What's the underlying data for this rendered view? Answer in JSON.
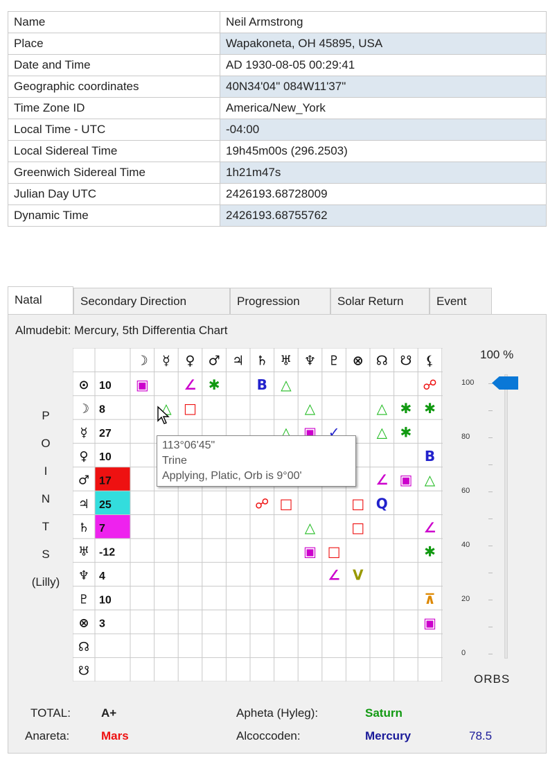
{
  "info": [
    {
      "key": "Name",
      "value": "Neil Armstrong"
    },
    {
      "key": "Place",
      "value": "Wapakoneta, OH 45895, USA"
    },
    {
      "key": "Date and Time",
      "value": "AD 1930-08-05 00:29:41"
    },
    {
      "key": "Geographic coordinates",
      "value": "40N34'04\" 084W11'37\""
    },
    {
      "key": "Time Zone ID",
      "value": "America/New_York"
    },
    {
      "key": "Local Time - UTC",
      "value": "-04:00"
    },
    {
      "key": "Local Sidereal Time",
      "value": "19h45m00s (296.2503)"
    },
    {
      "key": "Greenwich Sidereal Time",
      "value": "1h21m47s"
    },
    {
      "key": "Julian Day UTC",
      "value": "2426193.68728009"
    },
    {
      "key": "Dynamic Time",
      "value": "2426193.68755762"
    }
  ],
  "tabs": [
    {
      "label": "Natal",
      "active": true
    },
    {
      "label": "Secondary Direction",
      "active": false
    },
    {
      "label": "Progression",
      "active": false
    },
    {
      "label": "Solar Return",
      "active": false
    },
    {
      "label": "Event",
      "active": false
    }
  ],
  "chart_title": "Almudebit: Mercury, 5th Differentia Chart",
  "side_label": [
    "P",
    "O",
    "I",
    "N",
    "T",
    "S",
    "(Lilly)"
  ],
  "grid": {
    "columns": [
      "☽",
      "☿",
      "♀",
      "♂",
      "♃",
      "♄",
      "♅",
      "♆",
      "♇",
      "⊗",
      "☊",
      "☋",
      "⚸"
    ],
    "rows": [
      {
        "glyph": "⊙",
        "score": "10",
        "score_bg": ""
      },
      {
        "glyph": "☽",
        "score": "8",
        "score_bg": ""
      },
      {
        "glyph": "☿",
        "score": "27",
        "score_bg": ""
      },
      {
        "glyph": "♀",
        "score": "10",
        "score_bg": ""
      },
      {
        "glyph": "♂",
        "score": "17",
        "score_bg": "#ee1111"
      },
      {
        "glyph": "♃",
        "score": "25",
        "score_bg": "#33dddd"
      },
      {
        "glyph": "♄",
        "score": "7",
        "score_bg": "#ee22ee"
      },
      {
        "glyph": "♅",
        "score": "-12",
        "score_bg": ""
      },
      {
        "glyph": "♆",
        "score": "4",
        "score_bg": ""
      },
      {
        "glyph": "♇",
        "score": "10",
        "score_bg": ""
      },
      {
        "glyph": "⊗",
        "score": "3",
        "score_bg": ""
      },
      {
        "glyph": "☊",
        "score": "",
        "score_bg": ""
      },
      {
        "glyph": "☋",
        "score": "",
        "score_bg": ""
      }
    ],
    "aspects": [
      {
        "row": 0,
        "col": 0,
        "glyph": "▣",
        "color": "#cc00cc"
      },
      {
        "row": 0,
        "col": 2,
        "glyph": "∠",
        "color": "#cc00cc"
      },
      {
        "row": 0,
        "col": 3,
        "glyph": "✱",
        "color": "#119911"
      },
      {
        "row": 0,
        "col": 5,
        "glyph": "B",
        "color": "#2222cc"
      },
      {
        "row": 0,
        "col": 6,
        "glyph": "△",
        "color": "#22bb22"
      },
      {
        "row": 0,
        "col": 12,
        "glyph": "☍",
        "color": "#ee1111"
      },
      {
        "row": 1,
        "col": 1,
        "glyph": "△",
        "color": "#22bb22"
      },
      {
        "row": 1,
        "col": 2,
        "glyph": "□",
        "color": "#ee1111"
      },
      {
        "row": 1,
        "col": 7,
        "glyph": "△",
        "color": "#22bb22"
      },
      {
        "row": 1,
        "col": 10,
        "glyph": "△",
        "color": "#22bb22"
      },
      {
        "row": 1,
        "col": 11,
        "glyph": "✱",
        "color": "#119911"
      },
      {
        "row": 1,
        "col": 12,
        "glyph": "✱",
        "color": "#119911"
      },
      {
        "row": 2,
        "col": 6,
        "glyph": "△",
        "color": "#22bb22"
      },
      {
        "row": 2,
        "col": 7,
        "glyph": "▣",
        "color": "#cc00cc"
      },
      {
        "row": 2,
        "col": 8,
        "glyph": "✓",
        "color": "#2222cc"
      },
      {
        "row": 2,
        "col": 10,
        "glyph": "△",
        "color": "#22bb22"
      },
      {
        "row": 2,
        "col": 11,
        "glyph": "✱",
        "color": "#119911"
      },
      {
        "row": 3,
        "col": 12,
        "glyph": "B",
        "color": "#2222cc"
      },
      {
        "row": 4,
        "col": 10,
        "glyph": "∠",
        "color": "#cc00cc"
      },
      {
        "row": 4,
        "col": 11,
        "glyph": "▣",
        "color": "#cc00cc"
      },
      {
        "row": 4,
        "col": 12,
        "glyph": "△",
        "color": "#22bb22"
      },
      {
        "row": 5,
        "col": 5,
        "glyph": "☍",
        "color": "#ee1111"
      },
      {
        "row": 5,
        "col": 6,
        "glyph": "□",
        "color": "#ee1111"
      },
      {
        "row": 5,
        "col": 9,
        "glyph": "□",
        "color": "#ee1111"
      },
      {
        "row": 5,
        "col": 10,
        "glyph": "Q",
        "color": "#2222cc"
      },
      {
        "row": 6,
        "col": 7,
        "glyph": "△",
        "color": "#22bb22"
      },
      {
        "row": 6,
        "col": 9,
        "glyph": "□",
        "color": "#ee1111"
      },
      {
        "row": 6,
        "col": 12,
        "glyph": "∠",
        "color": "#cc00cc"
      },
      {
        "row": 7,
        "col": 7,
        "glyph": "▣",
        "color": "#cc00cc"
      },
      {
        "row": 7,
        "col": 8,
        "glyph": "□",
        "color": "#ee1111"
      },
      {
        "row": 7,
        "col": 12,
        "glyph": "✱",
        "color": "#119911"
      },
      {
        "row": 8,
        "col": 8,
        "glyph": "∠",
        "color": "#cc00cc"
      },
      {
        "row": 8,
        "col": 9,
        "glyph": "V",
        "color": "#999900"
      },
      {
        "row": 9,
        "col": 12,
        "glyph": "⊼",
        "color": "#dd8800"
      },
      {
        "row": 10,
        "col": 12,
        "glyph": "▣",
        "color": "#cc00cc"
      }
    ]
  },
  "tooltip": {
    "line1": "113°06'45\"",
    "line2": "Trine",
    "line3": "Applying, Platic, Orb is 9°00'"
  },
  "slider": {
    "label": "100 %",
    "value_percent": 100,
    "tick_labels": [
      "100",
      "80",
      "60",
      "40",
      "20",
      "0"
    ],
    "caption": "ORBS"
  },
  "summary": {
    "total_label": "TOTAL:",
    "total_value": "A+",
    "anareta_label": "Anareta:",
    "anareta_value": "Mars",
    "apheta_label": "Apheta (Hyleg):",
    "apheta_value": "Saturn",
    "alcoccoden_label": "Alcoccoden:",
    "alcoccoden_value": "Mercury",
    "alcoccoden_years": "78.5"
  },
  "colors": {
    "alt_row": "#dde7f0",
    "anareta": "#ee1111",
    "apheta": "#119911",
    "alcoccoden": "#1a1a99",
    "slider_thumb": "#0a78d7"
  }
}
